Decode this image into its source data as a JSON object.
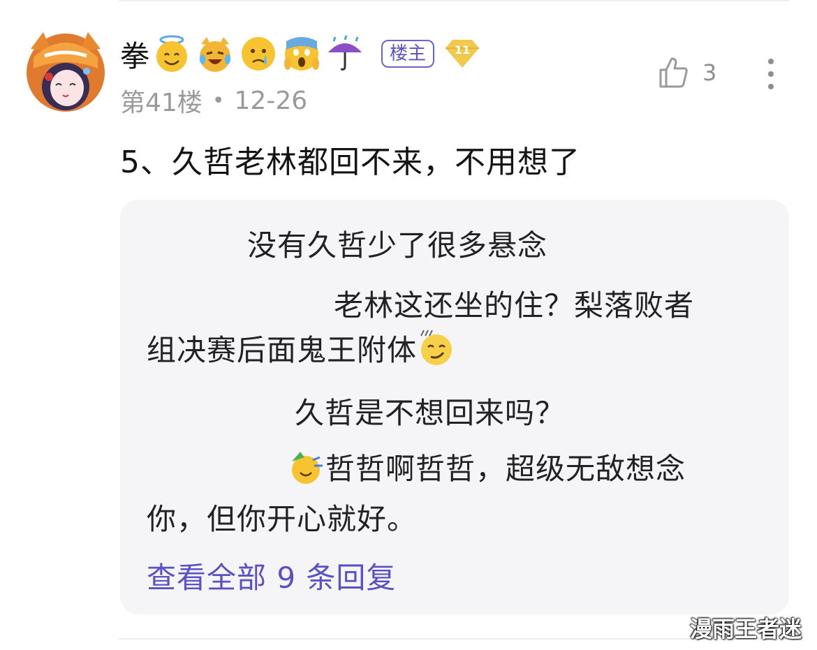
{
  "comment": {
    "author": {
      "name": "拳",
      "name_emojis": [
        "halo-smile-emoji",
        "joy-cat-emoji",
        "crying-emoji",
        "screaming-emoji",
        "umbrella-rain-emoji"
      ],
      "op_badge": "楼主",
      "level": "11"
    },
    "floor": "第41楼",
    "separator": "•",
    "date": "12-26",
    "likes": "3",
    "body": "5、久哲老林都回不来，不用想了"
  },
  "replies": {
    "lines": [
      "没有久哲少了很多悬念",
      "老林这还坐的住？梨落败者",
      "组决赛后面鬼王附体",
      "久哲是不想回来吗？",
      "哲哲啊哲哲，超级无敌想念",
      "你，但你开心就好。"
    ],
    "view_all": "查看全部 9 条回复"
  },
  "watermark": "漫雨王者迷",
  "colors": {
    "accent": "#5a52c4",
    "meta_text": "#9a9a9a",
    "reply_bg": "#f5f5f8",
    "level_badge": "#f2c94c"
  }
}
